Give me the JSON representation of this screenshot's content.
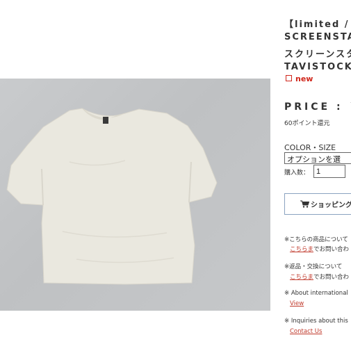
{
  "product": {
    "title_lines": [
      "【limited / 再",
      "SCREENSTA",
      "スクリーンスタ",
      "TAVISTOCK"
    ],
    "badge_new": "new",
    "price_label": "PRICE : ￥",
    "points": "60ポイント還元"
  },
  "options": {
    "label": "COLOR・SIZE",
    "selected": "オプションを選",
    "qty_label": "購入数：",
    "qty_value": "1"
  },
  "cart": {
    "label": "ショッピング",
    "icon": "cart-icon"
  },
  "notes": [
    {
      "text": "※こちらの商品について",
      "link_text": "こちらま",
      "link_suffix": "でお問い合わ"
    },
    {
      "text": "※返品・交換について",
      "link_text": "こちらま",
      "link_suffix": "でお問い合わ"
    },
    {
      "text": "※ About international",
      "link_text": "View",
      "link_suffix": ""
    },
    {
      "text": "※ Inquiries about this",
      "link_text": "Contact Us",
      "link_suffix": ""
    }
  ],
  "colors": {
    "accent_red": "#d0261b",
    "button_border": "#8aa3c0",
    "photo_bg": "#c4c6c8",
    "shirt": "#eae8df"
  }
}
